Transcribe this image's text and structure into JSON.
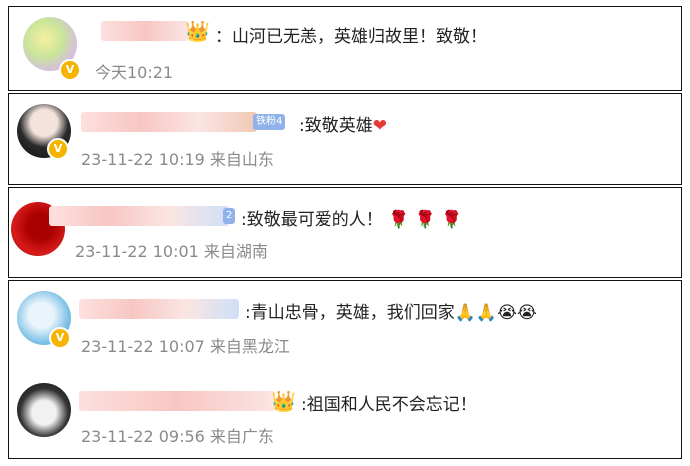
{
  "comments": [
    {
      "text": "：山河已无恙，英雄归故里！致敬！",
      "time": "今天10:21",
      "location": ""
    },
    {
      "fan_badge": "铁粉4",
      "text": ":致敬英雄",
      "time": "23-11-22 10:19",
      "location": "来自山东"
    },
    {
      "fan_badge": "2",
      "text": ":致敬最可爱的人！",
      "time": "23-11-22 10:01",
      "location": "来自湖南"
    },
    {
      "text": ":青山忠骨，英雄，我们回家",
      "time": "23-11-22 10:07",
      "location": "来自黑龙江"
    },
    {
      "text": ":祖国和人民不会忘记！",
      "time": "23-11-22 09:56",
      "location": "来自广东"
    }
  ],
  "icons": {
    "verified": "verified-v-badge",
    "crown": "crown-icon",
    "heart": "red-heart-icon",
    "rose": "rose-icon",
    "pray": "pray-hands-icon",
    "cry": "crying-face-icon"
  },
  "colors": {
    "meta_text": "#8a8a8a",
    "verified_badge": "#f4b400",
    "fan_badge": "#8fb2ea"
  }
}
